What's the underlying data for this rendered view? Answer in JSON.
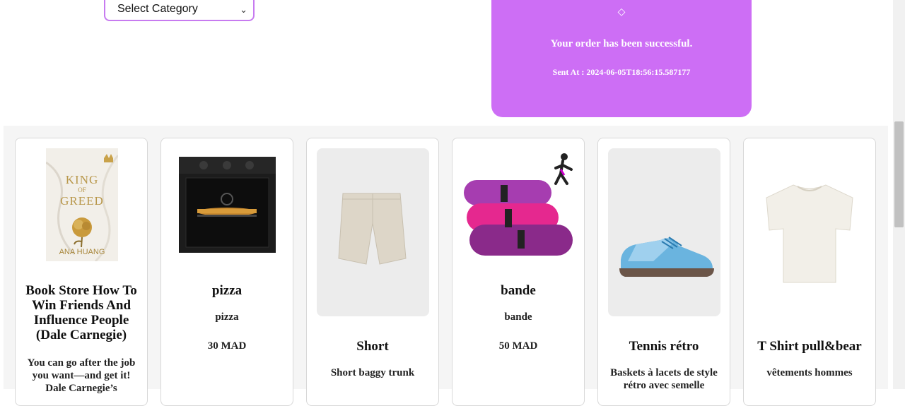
{
  "filter": {
    "select_label": "Select Category"
  },
  "toast": {
    "icon": "◇",
    "message": "Your order has been successful.",
    "sent_at": "Sent At : 2024-06-05T18:56:15.587177"
  },
  "book_cover": {
    "title_line1": "KING",
    "title_line2": "OF",
    "title_line3": "GREED",
    "author": "ANA HUANG"
  },
  "products": [
    {
      "name": "Book Store How To Win Friends And Influence People (Dale Carnegie)",
      "description": "You can go after the job you want—and get it! Dale Carnegie’s",
      "image_icon": "book-cover-image"
    },
    {
      "name": "pizza",
      "description": "pizza",
      "price": "30 MAD",
      "image_icon": "oven-image"
    },
    {
      "name": "Short",
      "description": "Short baggy trunk",
      "image_icon": "shorts-image"
    },
    {
      "name": "bande",
      "description": "bande",
      "price": "50 MAD",
      "image_icon": "resistance-bands-image"
    },
    {
      "name": "Tennis rétro",
      "description": "Baskets à lacets de style rétro avec semelle",
      "image_icon": "sneaker-image"
    },
    {
      "name": "T Shirt pull&bear",
      "description": "vêtements hommes",
      "image_icon": "tshirt-image"
    }
  ],
  "colors": {
    "accent": "#cd6ef5",
    "select_border": "#c77bf0"
  }
}
